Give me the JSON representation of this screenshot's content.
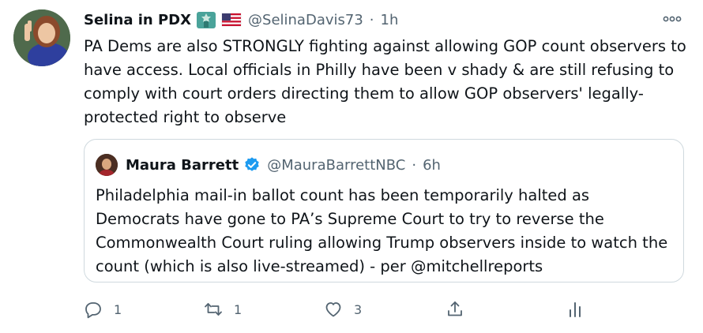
{
  "tweet": {
    "author_name": "Selina in PDX",
    "author_emojis": [
      "statue-of-liberty-icon",
      "us-flag-icon"
    ],
    "handle": "@SelinaDavis73",
    "separator": "·",
    "time": "1h",
    "text": "PA Dems are also STRONGLY fighting against allowing GOP count observers to have access. Local officials in Philly have been v shady & are still refusing to comply with court orders directing them to allow GOP observers' legally-protected right to observe"
  },
  "quoted": {
    "author_name": "Maura Barrett",
    "verified": true,
    "handle": "@MauraBarrettNBC",
    "separator": "·",
    "time": "6h",
    "text": "Philadelphia mail-in ballot count has been temporarily halted as Democrats have gone to PA’s Supreme Court to try to reverse the Commonwealth Court ruling allowing Trump observers inside to watch the count (which is also live-streamed) - per @mitchellreports"
  },
  "actions": {
    "reply_count": "1",
    "retweet_count": "1",
    "like_count": "3"
  },
  "colors": {
    "text": "#0f1419",
    "muted": "#536471",
    "border": "#cfd9de",
    "verified": "#1d9bf0"
  }
}
